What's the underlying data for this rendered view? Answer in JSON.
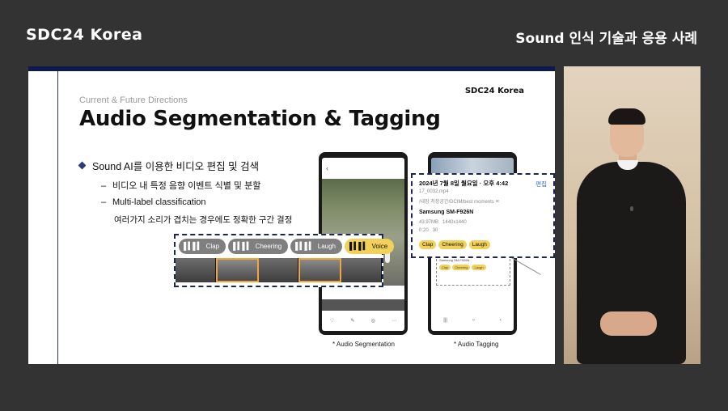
{
  "header": {
    "brand": "SDC24 Korea",
    "session_title": "Sound 인식 기술과 응용 사례"
  },
  "slide": {
    "brand": "SDC24 Korea",
    "eyebrow": "Current & Future Directions",
    "title": "Audio Segmentation & Tagging",
    "bullet": "Sound AI를 이용한 비디오 편집 및 검색",
    "sub_items": [
      "비디오 내 특정 음향 이벤트 식별 및 분할",
      "Multi-label classification",
      "여러가지 소리가 겹치는 경우에도 정확한 구간 결정"
    ],
    "tags": [
      "Clap",
      "Cheering",
      "Laugh",
      "Voice"
    ],
    "captions": [
      "* Audio Segmentation",
      "* Audio Tagging"
    ],
    "details": {
      "date": "2024년 7월 8일 월요일 · 오후 4:42",
      "edit": "편집",
      "filename": "17_0032.mp4",
      "path": "/내장 저장공간/DCIM/best moments ㄸ",
      "device": "Samsung SM-F926N",
      "size": "43.97MB",
      "resolution": "1440x1440",
      "duration_a": "0:20",
      "duration_b": "30",
      "chips": [
        "Clap",
        "Cheering",
        "Laugh"
      ]
    }
  },
  "colors": {
    "background": "#333333",
    "accent_navy": "#101a4a",
    "tag_active": "#f2d15a",
    "tag_inactive": "#7f7f7f",
    "frame_highlight": "#f0a63a"
  },
  "icons": [
    "diamond-bullet-icon",
    "sound-wave-icon",
    "back-arrow-icon"
  ]
}
